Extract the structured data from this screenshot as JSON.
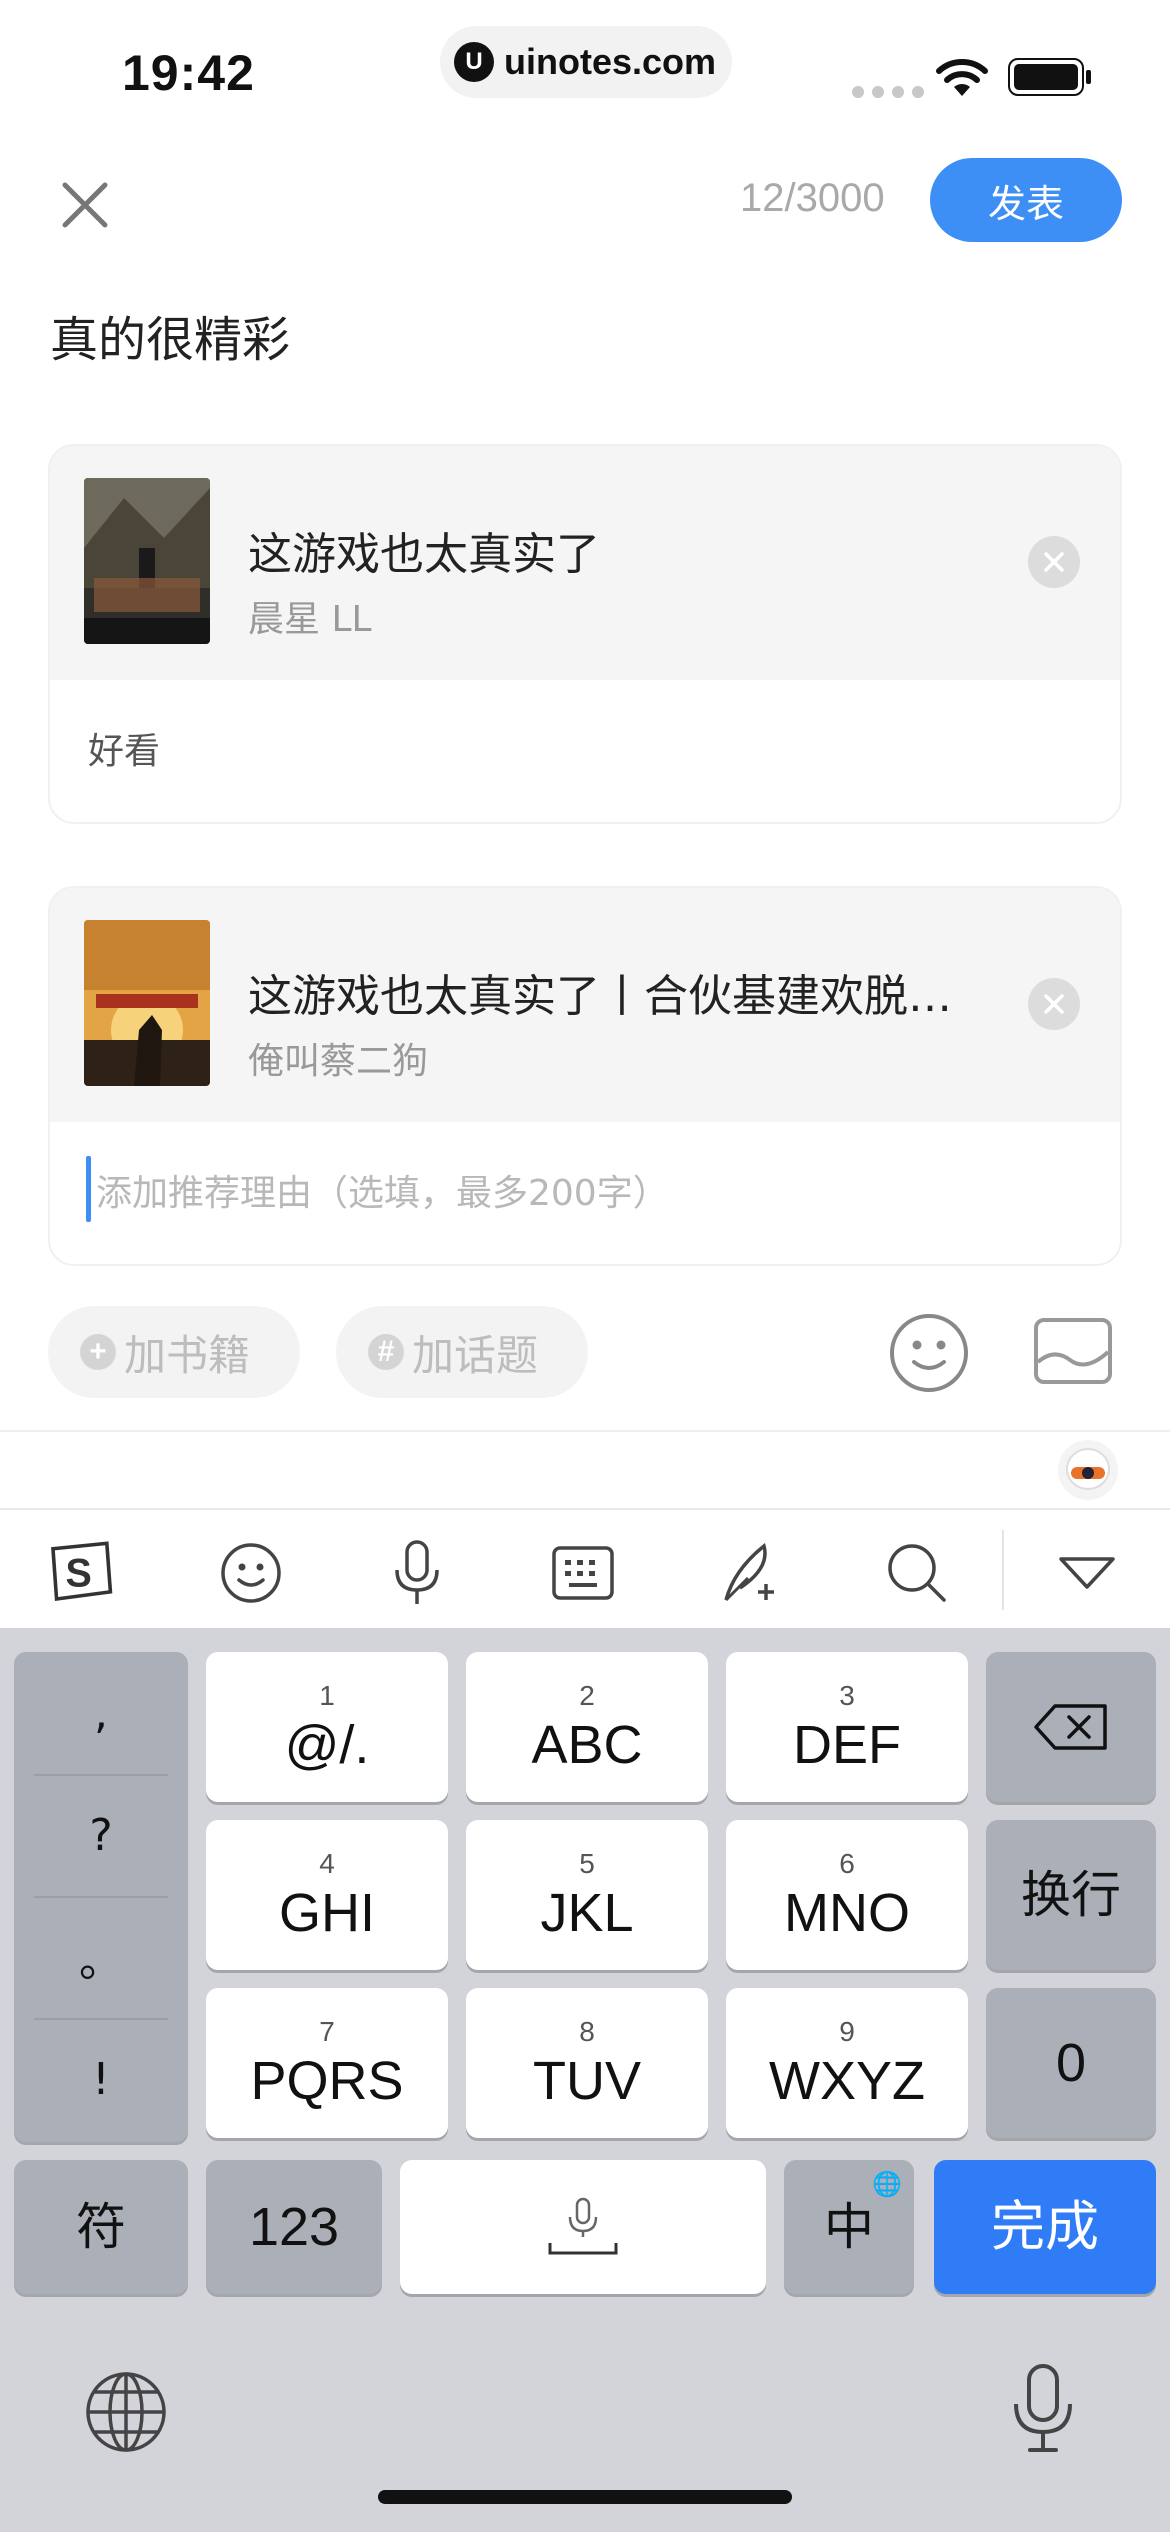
{
  "status": {
    "time": "19:42",
    "url": "uinotes.com"
  },
  "header": {
    "char_count": "12/3000",
    "publish_label": "发表"
  },
  "post": {
    "text": "真的很精彩"
  },
  "books": [
    {
      "title": "这游戏也太真实了",
      "author": "晨星 LL",
      "reason": "好看",
      "cover_colors": [
        "#3b3a32",
        "#8a5a3a"
      ]
    },
    {
      "title": "这游戏也太真实了丨合伙基建欢脱…",
      "author": "俺叫蔡二狗",
      "reason_placeholder": "添加推荐理由（选填，最多200字）",
      "cover_colors": [
        "#d9a441",
        "#3a2a1a"
      ]
    }
  ],
  "actions": {
    "add_book": "加书籍",
    "add_topic": "加话题"
  },
  "keyboard": {
    "punctuation": [
      ",",
      "?",
      "。",
      "!"
    ],
    "keys": [
      {
        "num": "1",
        "label": "@/."
      },
      {
        "num": "2",
        "label": "ABC"
      },
      {
        "num": "3",
        "label": "DEF"
      },
      {
        "num": "4",
        "label": "GHI"
      },
      {
        "num": "5",
        "label": "JKL"
      },
      {
        "num": "6",
        "label": "MNO"
      },
      {
        "num": "7",
        "label": "PQRS"
      },
      {
        "num": "8",
        "label": "TUV"
      },
      {
        "num": "9",
        "label": "WXYZ"
      }
    ],
    "newline": "换行",
    "zero": "0",
    "symbols": "符",
    "numbers": "123",
    "chinese": "中",
    "done": "完成"
  },
  "colors": {
    "accent": "#3d8ff5",
    "done": "#2f7cf6"
  }
}
